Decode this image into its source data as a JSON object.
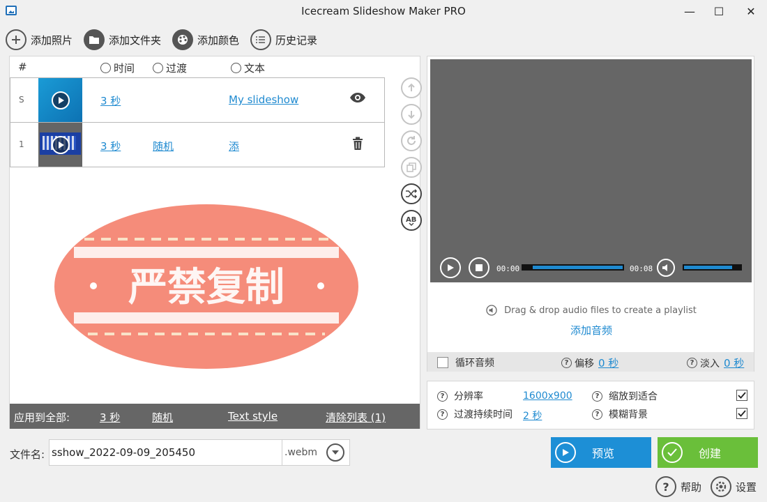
{
  "window": {
    "title": "Icecream Slideshow Maker PRO",
    "minimize_glyph": "—",
    "maximize_glyph": "☐",
    "close_glyph": "✕"
  },
  "toolbar": {
    "add_photos": "添加照片",
    "add_folder": "添加文件夹",
    "add_color": "添加颜色",
    "history": "历史记录"
  },
  "list": {
    "headers": {
      "num": "#",
      "time": "时间",
      "transition": "过渡",
      "text": "文本"
    },
    "rows": [
      {
        "num": "S",
        "time": "3 秒",
        "transition": "",
        "text": "My slideshow",
        "action_icon": "eye-icon"
      },
      {
        "num": "1",
        "time": "3 秒",
        "transition": "随机",
        "text": "添",
        "action_icon": "trash-icon"
      }
    ]
  },
  "watermark": {
    "text": "严禁复制",
    "color": "#f47f6c"
  },
  "apply_bar": {
    "label": "应用到全部:",
    "time": "3 秒",
    "transition": "随机",
    "text_style": "Text style",
    "clear_list": "清除列表 (1)"
  },
  "player": {
    "current_time": "00:00",
    "total_time": "00:08",
    "progress": 0,
    "volume": 0.85
  },
  "audio": {
    "drop_message": "Drag & drop audio files to create a playlist",
    "add_audio": "添加音频",
    "loop_label": "循环音频",
    "loop_checked": false,
    "offset_label": "偏移",
    "offset_value": "0 秒",
    "fadein_label": "淡入",
    "fadein_value": "0 秒"
  },
  "settings": {
    "resolution_label": "分辨率",
    "resolution_value": "1600x900",
    "transition_duration_label": "过渡持续时间",
    "transition_duration_value": "2 秒",
    "scale_fit_label": "缩放到适合",
    "scale_fit_checked": true,
    "blur_bg_label": "模糊背景",
    "blur_bg_checked": true
  },
  "output": {
    "filename_label": "文件名:",
    "filename_value": "sshow_2022-09-09_205450",
    "extension": ".webm"
  },
  "actions": {
    "preview": "预览",
    "create": "创建",
    "help": "帮助",
    "settings": "设置"
  },
  "colors": {
    "accent": "#1f8ad0",
    "preview_button": "#1d8fd6",
    "create_button": "#6abf3a",
    "video_bg": "#666666",
    "apply_bar_bg": "#666666"
  }
}
